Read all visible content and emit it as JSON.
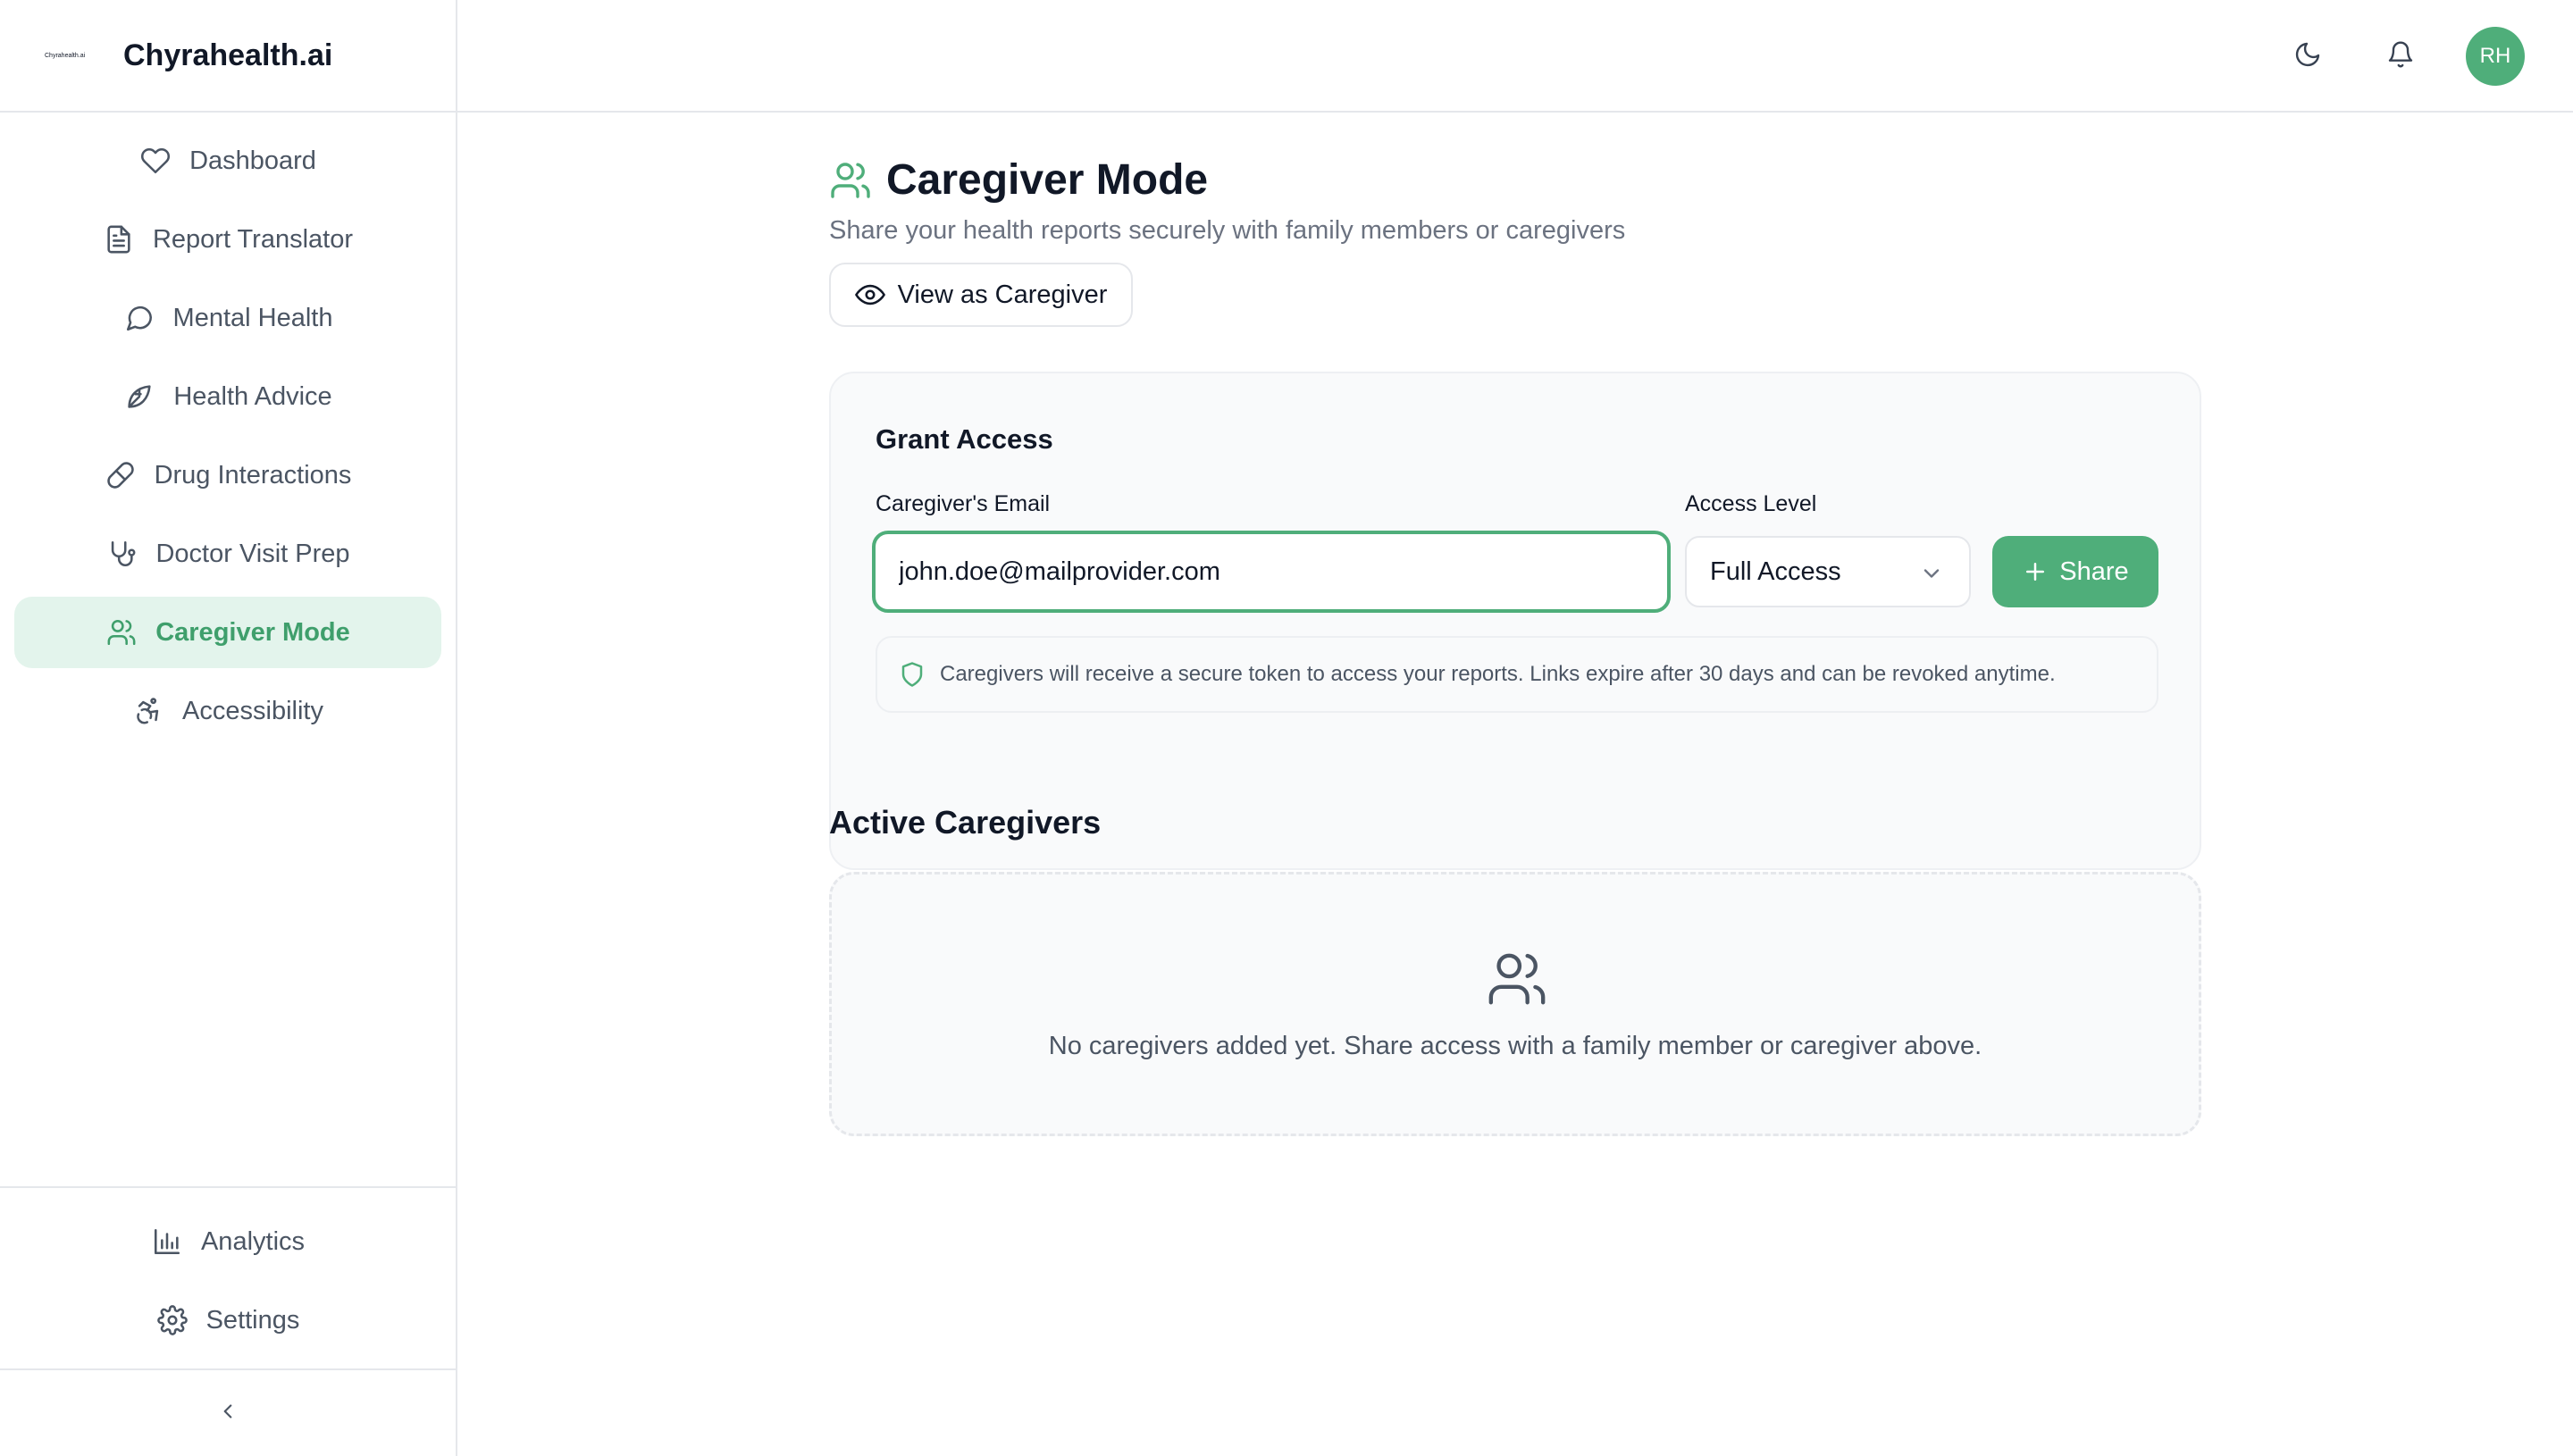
{
  "brand": {
    "logo_text": "Chyrahealth.ai",
    "name": "Chyrahealth.ai"
  },
  "nav": {
    "items": [
      {
        "label": "Dashboard",
        "icon": "heart-icon"
      },
      {
        "label": "Report Translator",
        "icon": "file-text-icon"
      },
      {
        "label": "Mental Health",
        "icon": "message-circle-icon"
      },
      {
        "label": "Health Advice",
        "icon": "leaf-icon"
      },
      {
        "label": "Drug Interactions",
        "icon": "pill-icon"
      },
      {
        "label": "Doctor Visit Prep",
        "icon": "stethoscope-icon"
      },
      {
        "label": "Caregiver Mode",
        "icon": "users-icon",
        "active": true
      },
      {
        "label": "Accessibility",
        "icon": "accessibility-icon"
      }
    ],
    "bottom": [
      {
        "label": "Analytics",
        "icon": "bar-chart-icon"
      },
      {
        "label": "Settings",
        "icon": "gear-icon"
      }
    ],
    "collapse_icon": "chevron-left-icon"
  },
  "topbar": {
    "theme_icon": "moon-icon",
    "notifications_icon": "bell-icon",
    "avatar_initials": "RH"
  },
  "page": {
    "title": "Caregiver Mode",
    "subtitle": "Share your health reports securely with family members or caregivers",
    "view_button": "View as Caregiver"
  },
  "grant": {
    "title": "Grant Access",
    "email_label": "Caregiver's Email",
    "email_value": "john.doe@mailprovider.com",
    "access_label": "Access Level",
    "access_selected": "Full Access",
    "share_label": "Share",
    "info_text": "Caregivers will receive a secure token to access your reports. Links expire after 30 days and can be revoked anytime."
  },
  "active": {
    "title": "Active Caregivers",
    "empty_text": "No caregivers added yet. Share access with a family member or caregiver above."
  },
  "colors": {
    "accent": "#4fae7a",
    "accent_light": "#e3f4ec",
    "border": "#e5e7eb"
  }
}
